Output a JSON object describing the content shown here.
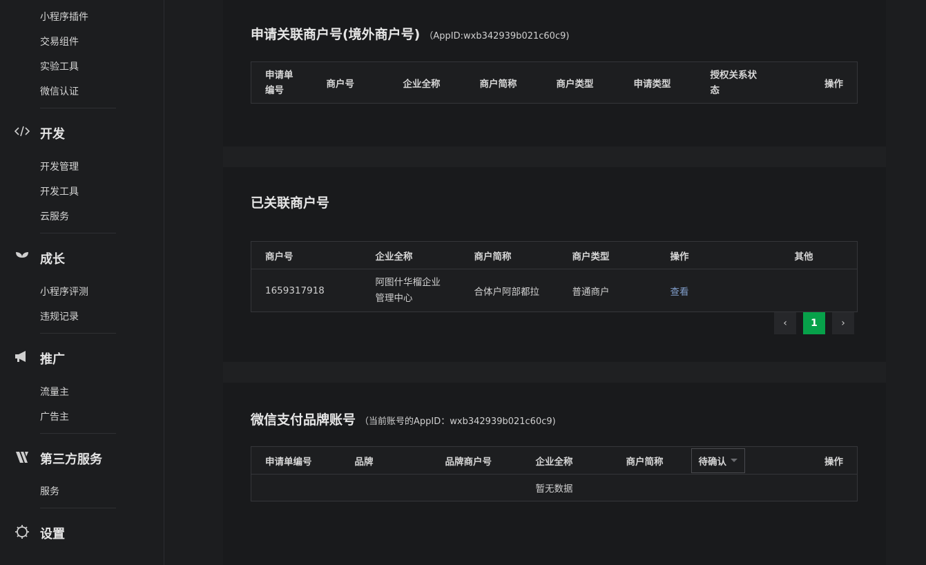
{
  "sidebar": {
    "items_top": [
      "小程序插件",
      "交易组件",
      "实验工具",
      "微信认证"
    ],
    "categories": {
      "dev": {
        "label": "开发",
        "items": [
          "开发管理",
          "开发工具",
          "云服务"
        ]
      },
      "growth": {
        "label": "成长",
        "items": [
          "小程序评测",
          "违规记录"
        ]
      },
      "promo": {
        "label": "推广",
        "items": [
          "流量主",
          "广告主"
        ]
      },
      "third": {
        "label": "第三方服务",
        "items": [
          "服务"
        ]
      },
      "settings": {
        "label": "设置"
      }
    }
  },
  "section1": {
    "title": "申请关联商户号(境外商户号)",
    "subtitle": "（AppID:wxb342939b021c60c9)",
    "columns": [
      "申请单\n编号",
      "商户号",
      "企业全称",
      "商户简称",
      "商户类型",
      "申请类型",
      "授权关系状\n态",
      "操作"
    ]
  },
  "section2": {
    "title": "已关联商户号",
    "columns": [
      "商户号",
      "企业全称",
      "商户简称",
      "商户类型",
      "操作",
      "其他"
    ],
    "rows": [
      {
        "merchant_id": "1659317918",
        "company": "阿图什华榴企业\n管理中心",
        "short_name": "合体户阿部都拉",
        "type": "普通商户",
        "action": "查看",
        "other": ""
      }
    ],
    "pagination": {
      "prev": "‹",
      "current": "1",
      "next": "›"
    }
  },
  "section3": {
    "title": "微信支付品牌账号",
    "subtitle": "（当前账号的AppID：wxb342939b021c60c9)",
    "columns": [
      "申请单编号",
      "品牌",
      "品牌商户号",
      "企业全称",
      "商户简称",
      "待确认",
      "操作"
    ],
    "empty_text": "暂无数据"
  }
}
